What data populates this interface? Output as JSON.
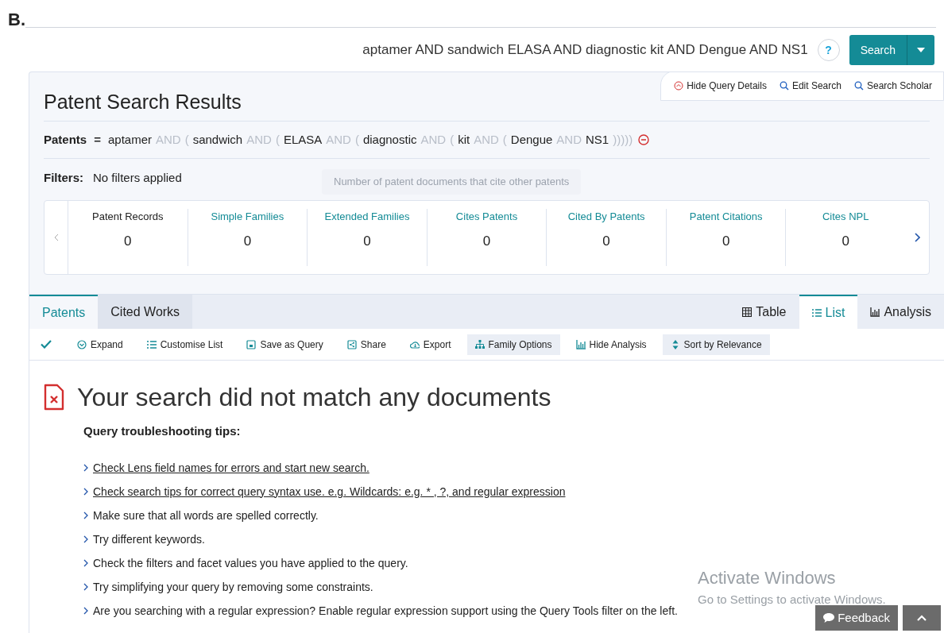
{
  "figure_label": "B.",
  "search_bar": {
    "query": "aptamer AND sandwich ELASA AND diagnostic kit AND Dengue AND NS1",
    "help": "?",
    "button": "Search"
  },
  "query_links": [
    {
      "label": "Hide Query Details",
      "kind": "hide"
    },
    {
      "label": "Edit Search",
      "kind": "search"
    },
    {
      "label": "Search Scholar",
      "kind": "search"
    }
  ],
  "title": "Patent Search Results",
  "query": {
    "label": "Patents",
    "equals": "=",
    "tokens": [
      {
        "text": "aptamer",
        "kind": "term"
      },
      {
        "text": "AND",
        "kind": "op"
      },
      {
        "text": "(",
        "kind": "op"
      },
      {
        "text": "sandwich",
        "kind": "term"
      },
      {
        "text": "AND",
        "kind": "op"
      },
      {
        "text": "(",
        "kind": "op"
      },
      {
        "text": "ELASA",
        "kind": "term"
      },
      {
        "text": "AND",
        "kind": "op"
      },
      {
        "text": "(",
        "kind": "op"
      },
      {
        "text": "diagnostic",
        "kind": "term"
      },
      {
        "text": "AND",
        "kind": "op"
      },
      {
        "text": "(",
        "kind": "op"
      },
      {
        "text": "kit",
        "kind": "term"
      },
      {
        "text": "AND",
        "kind": "op"
      },
      {
        "text": "(",
        "kind": "op"
      },
      {
        "text": "Dengue",
        "kind": "term"
      },
      {
        "text": "AND",
        "kind": "op"
      },
      {
        "text": "NS1",
        "kind": "term"
      },
      {
        "text": ")))))",
        "kind": "op"
      }
    ]
  },
  "filters": {
    "label": "Filters:",
    "value": "No filters applied"
  },
  "tooltip": "Number of patent documents that cite other patents",
  "stats": [
    {
      "label": "Patent Records",
      "value": "0",
      "kind": "plain"
    },
    {
      "label": "Simple Families",
      "value": "0",
      "kind": "link"
    },
    {
      "label": "Extended Families",
      "value": "0",
      "kind": "link"
    },
    {
      "label": "Cites Patents",
      "value": "0",
      "kind": "link"
    },
    {
      "label": "Cited By Patents",
      "value": "0",
      "kind": "link"
    },
    {
      "label": "Patent Citations",
      "value": "0",
      "kind": "link"
    },
    {
      "label": "Cites NPL",
      "value": "0",
      "kind": "link"
    }
  ],
  "tabs": [
    {
      "label": "Patents",
      "selected": true
    },
    {
      "label": "Cited Works",
      "selected": false
    }
  ],
  "view_tabs": [
    {
      "label": "Table",
      "kind": "table",
      "selected": false
    },
    {
      "label": "List",
      "kind": "list",
      "selected": true
    },
    {
      "label": "Analysis",
      "kind": "chart",
      "selected": false
    }
  ],
  "toolbar": [
    {
      "label": "Expand",
      "kind": "expand",
      "highlighted": false
    },
    {
      "label": "Customise List",
      "kind": "list",
      "highlighted": false
    },
    {
      "label": "Save as Query",
      "kind": "save",
      "highlighted": false
    },
    {
      "label": "Share",
      "kind": "share",
      "highlighted": false
    },
    {
      "label": "Export",
      "kind": "cloud",
      "highlighted": false
    },
    {
      "label": "Family Options",
      "kind": "tree",
      "highlighted": true
    },
    {
      "label": "Hide Analysis",
      "kind": "chart",
      "highlighted": false
    },
    {
      "label": "Sort by Relevance",
      "kind": "sort",
      "highlighted": true
    }
  ],
  "empty": {
    "heading": "Your search did not match any documents",
    "subheading": "Query troubleshooting tips:",
    "tips": [
      {
        "text": "Check Lens field names for errors and start new search.",
        "link": true
      },
      {
        "text": "Check search tips for correct query syntax use. e.g. Wildcards: e.g. * , ?, and regular expression",
        "link": true
      },
      {
        "text": "Make sure that all words are spelled correctly.",
        "link": false
      },
      {
        "text": "Try different keywords.",
        "link": false
      },
      {
        "text": "Check the filters and facet values you have applied to the query.",
        "link": false
      },
      {
        "text": "Try simplifying your query by removing some constraints.",
        "link": false
      },
      {
        "text": "Are you searching with a regular expression? Enable regular expression support using the Query Tools filter on the left.",
        "link": false
      }
    ]
  },
  "os_notice": {
    "title": "Activate Windows",
    "text": "Go to Settings to activate Windows."
  },
  "feedback": "Feedback"
}
